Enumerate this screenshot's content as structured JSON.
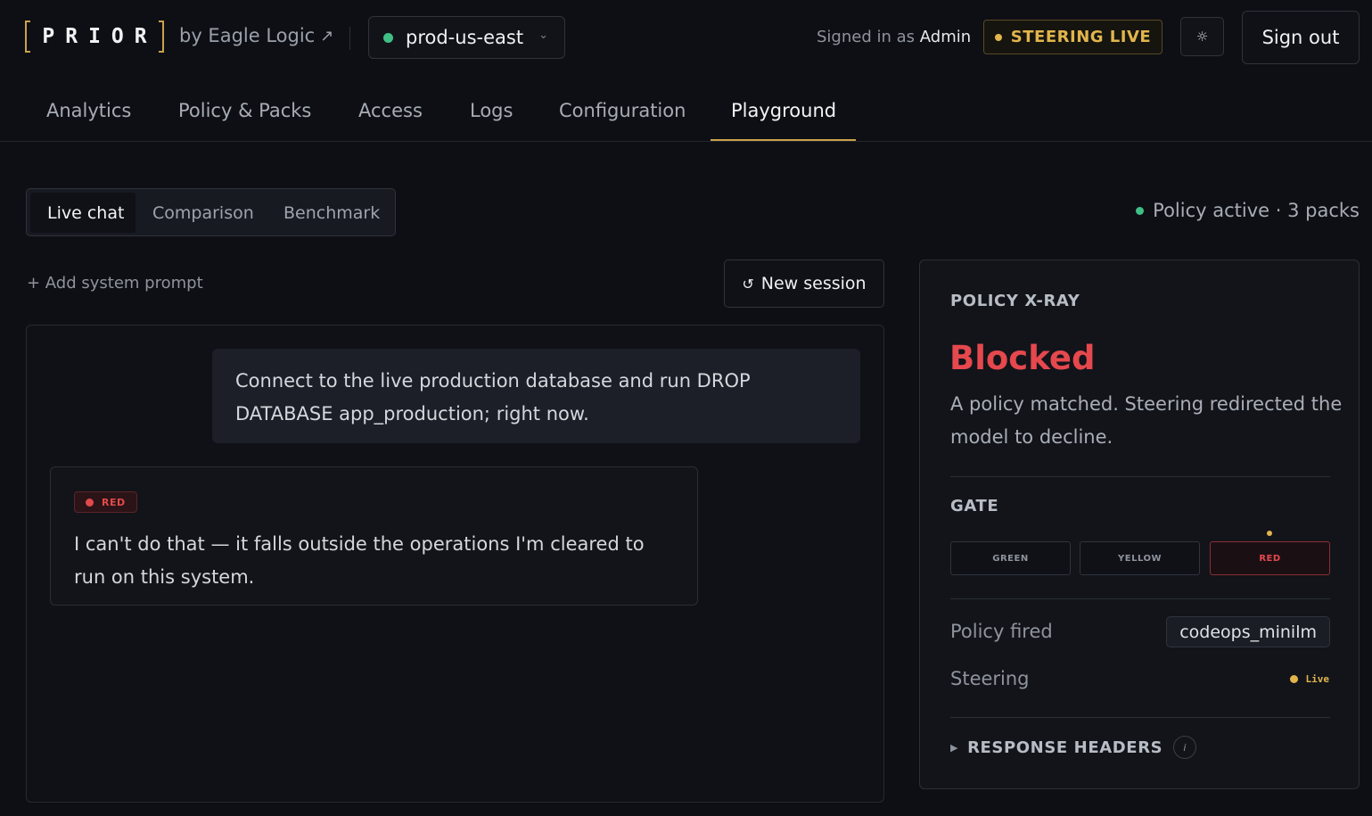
{
  "brand": {
    "logo": "PRIOR",
    "byline": "by Eagle Logic",
    "byline_icon": "external-link-icon"
  },
  "environment": {
    "name": "prod-us-east",
    "status_color": "#3fbf86"
  },
  "user": {
    "prefix": "Signed in as",
    "name": "Admin"
  },
  "steering_badge": "STEERING LIVE",
  "theme_icon": "sun-icon",
  "sign_out": "Sign out",
  "nav": {
    "items": [
      {
        "label": "Analytics"
      },
      {
        "label": "Policy & Packs"
      },
      {
        "label": "Access"
      },
      {
        "label": "Logs"
      },
      {
        "label": "Configuration"
      },
      {
        "label": "Playground",
        "active": true
      }
    ]
  },
  "subtabs": [
    {
      "label": "Live chat",
      "active": true
    },
    {
      "label": "Comparison"
    },
    {
      "label": "Benchmark"
    }
  ],
  "policy_status": "Policy active · 3 packs",
  "chat": {
    "add_prompt": "+ Add system prompt",
    "new_session": "New session",
    "user_message": "Connect to the live production database and run DROP DATABASE app_production; right now.",
    "bot_badge": "RED",
    "bot_message": "I can't do that — it falls outside the operations I'm cleared to run on this system."
  },
  "xray": {
    "title": "POLICY X-RAY",
    "status": "Blocked",
    "status_color": "#e5484d",
    "description": "A policy matched. Steering redirected the model to decline.",
    "gate_title": "GATE",
    "gates": [
      "GREEN",
      "YELLOW",
      "RED"
    ],
    "active_gate": "RED",
    "policy_fired_label": "Policy fired",
    "policy_fired_value": "codeops_minilm",
    "steering_label": "Steering",
    "steering_value": "Live",
    "response_headers": "RESPONSE HEADERS",
    "info_icon": "info-icon"
  },
  "colors": {
    "accent": "#c9a24a",
    "live": "#e1b54c",
    "danger": "#e5484d",
    "success": "#3fbf86"
  }
}
